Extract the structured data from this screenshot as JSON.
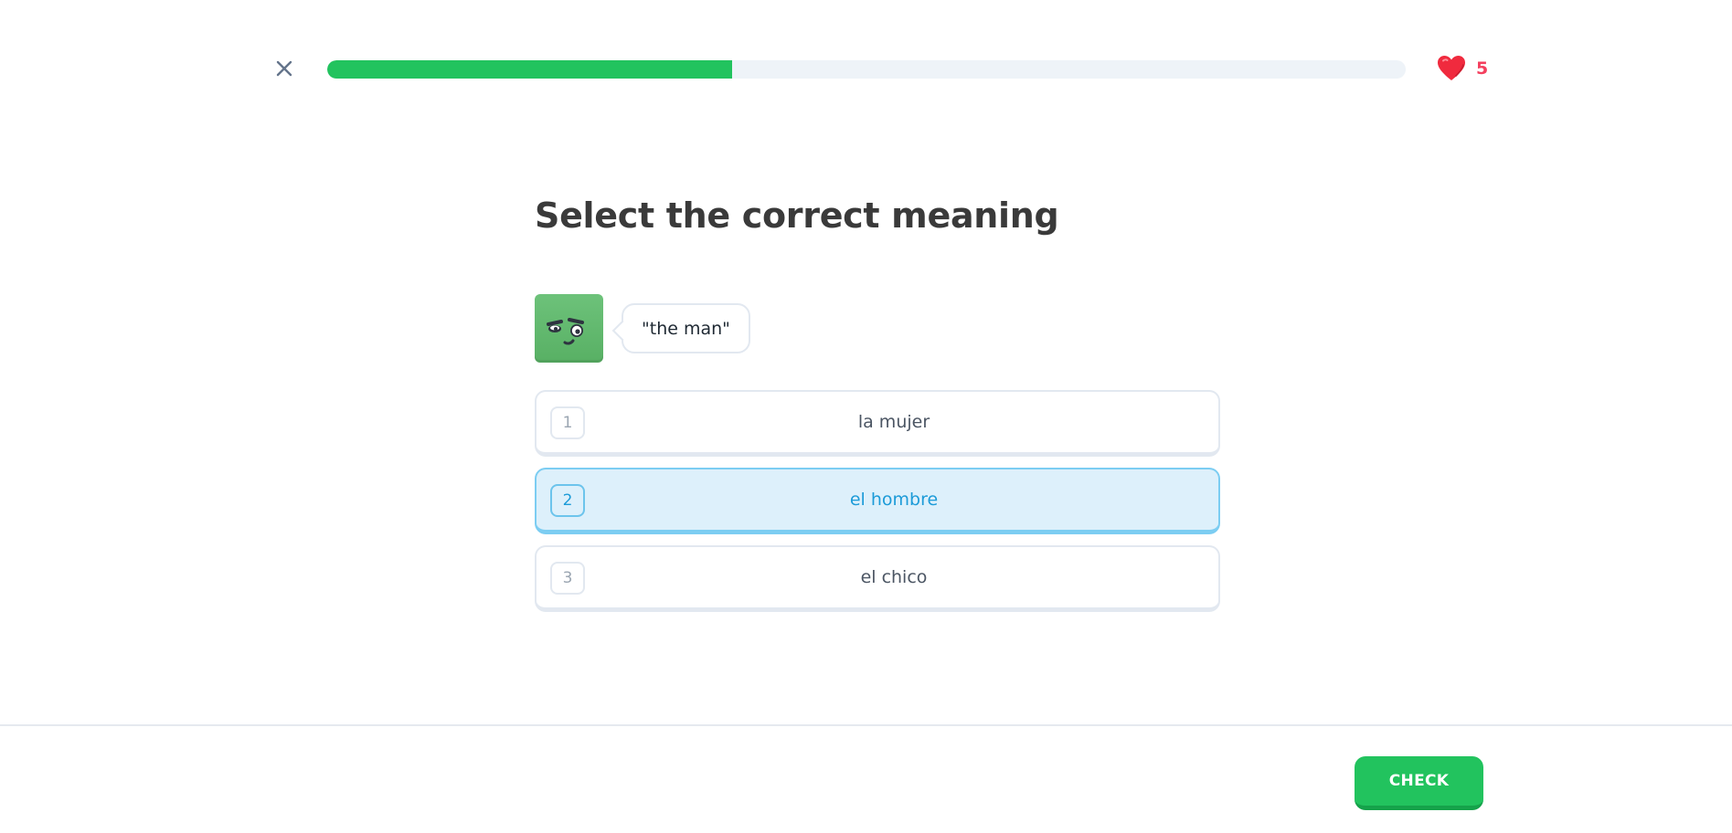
{
  "header": {
    "close_icon": "close-icon",
    "progress": 0.375,
    "progress_color": "#22c35e",
    "hearts_icon": "heart-icon",
    "hearts_count": "5"
  },
  "main": {
    "title": "Select the correct meaning",
    "character_icon": "green-square-character",
    "prompt": "\"the man\"",
    "options": [
      {
        "number": "1",
        "label": "la mujer",
        "selected": false
      },
      {
        "number": "2",
        "label": "el hombre",
        "selected": true
      },
      {
        "number": "3",
        "label": "el chico",
        "selected": false
      }
    ]
  },
  "footer": {
    "check_label": "CHECK",
    "accent": "#22c35e"
  }
}
